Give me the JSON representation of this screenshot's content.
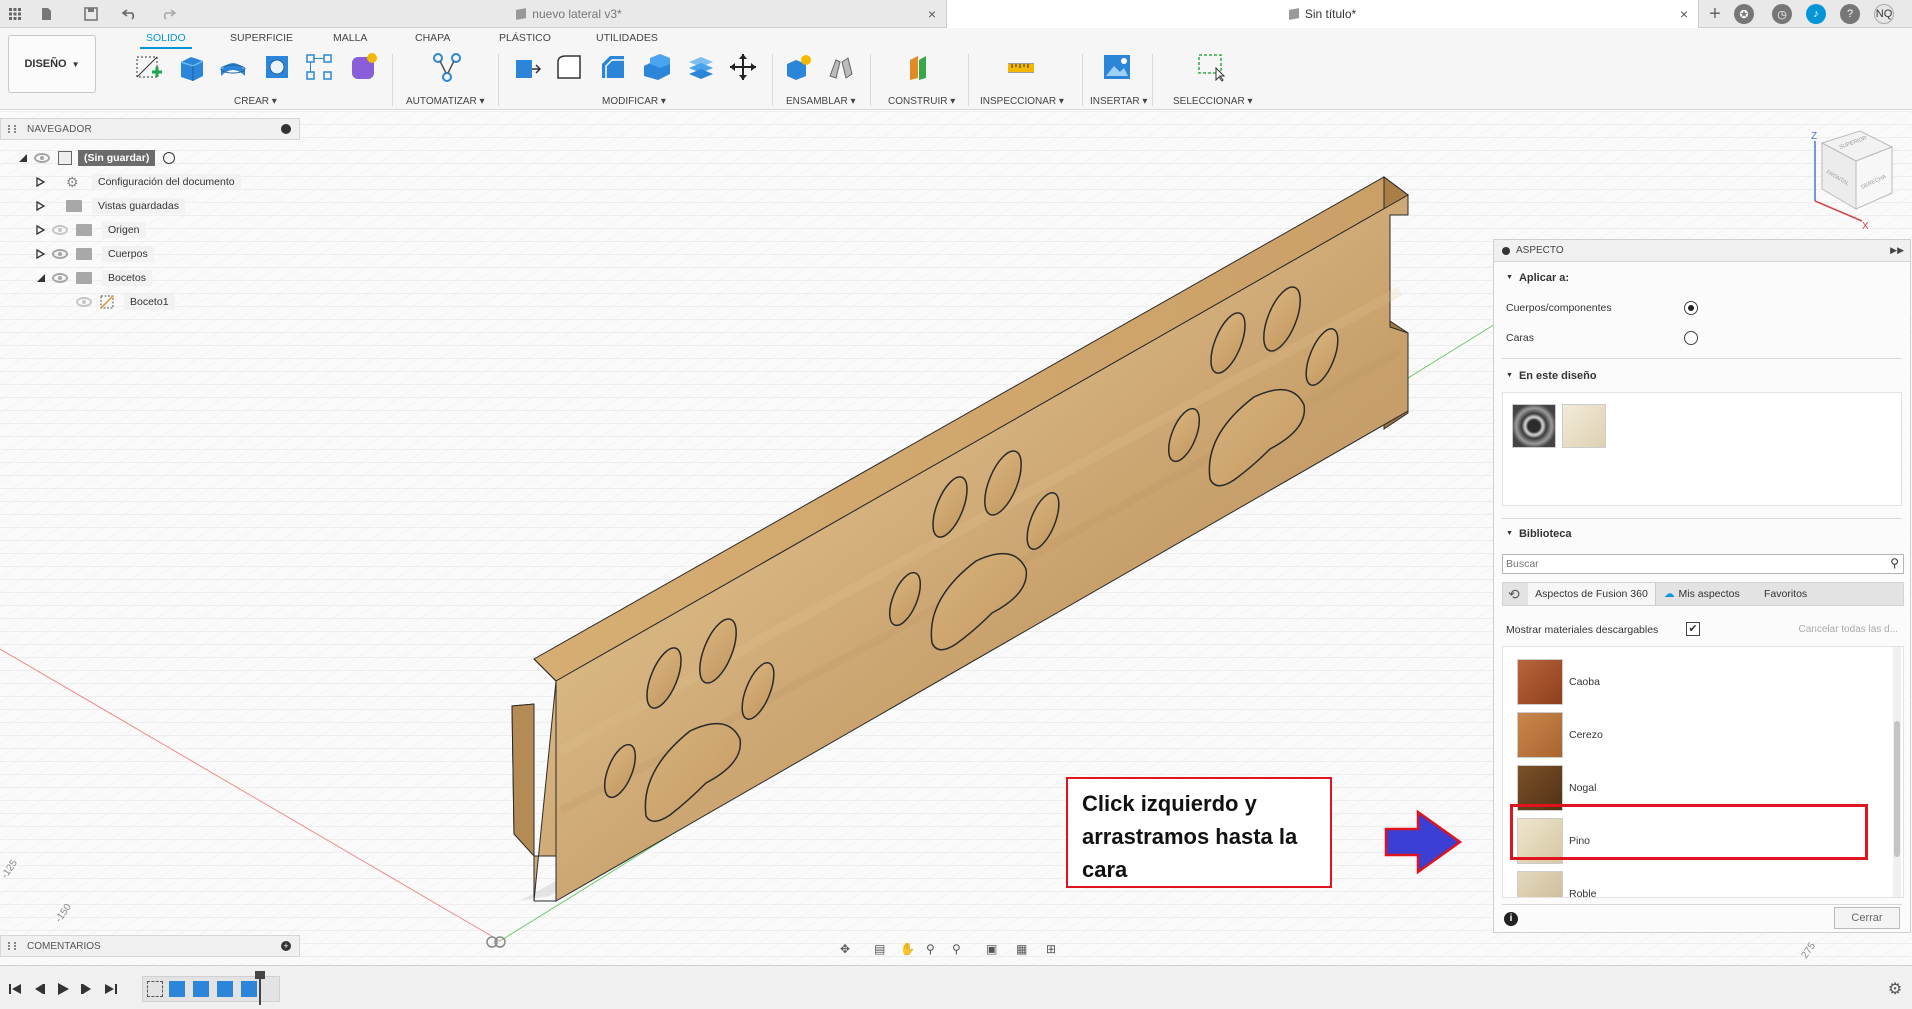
{
  "titlebar": {
    "tabs": [
      {
        "label": "nuevo lateral v3*",
        "active": false
      },
      {
        "label": "Sin título*",
        "active": true
      }
    ],
    "user_initials": "NQ"
  },
  "ribbon": {
    "workspace": "DISEÑO",
    "tabs": [
      "SOLIDO",
      "SUPERFICIE",
      "MALLA",
      "CHAPA",
      "PLÁSTICO",
      "UTILIDADES"
    ],
    "active_tab": "SOLIDO",
    "groups": [
      "CREAR",
      "AUTOMATIZAR",
      "MODIFICAR",
      "ENSAMBLAR",
      "CONSTRUIR",
      "INSPECCIONAR",
      "INSERTAR",
      "SELECCIONAR"
    ]
  },
  "navigator": {
    "title": "NAVEGADOR",
    "root": "(Sin guardar)",
    "items": [
      {
        "label": "Configuración del documento"
      },
      {
        "label": "Vistas guardadas"
      },
      {
        "label": "Origen"
      },
      {
        "label": "Cuerpos"
      },
      {
        "label": "Bocetos"
      },
      {
        "label": "Boceto1"
      }
    ]
  },
  "comments": {
    "title": "COMENTARIOS"
  },
  "viewcube": {
    "axis_z": "Z",
    "axis_x": "X",
    "face_top": "SUPERIOR",
    "face_front": "FRONTAL",
    "face_right": "DERECHA"
  },
  "grid_labels": {
    "left_a": "-125",
    "left_b": "-150",
    "right": "275"
  },
  "aspecto": {
    "title": "ASPECTO",
    "apply_section": "Aplicar a:",
    "option_bodies": "Cuerpos/componentes",
    "option_faces": "Caras",
    "design_section": "En este diseño",
    "library_section": "Biblioteca",
    "search_placeholder": "Buscar",
    "lib_tab_fusion": "Aspectos de Fusion 360",
    "lib_tab_mine": "Mis aspectos",
    "lib_tab_fav": "Favoritos",
    "show_downloadable": "Mostrar materiales descargables",
    "cancel_all": "Cancelar todas las d...",
    "materials": [
      {
        "name": "Caoba",
        "color": "#a4542e"
      },
      {
        "name": "Cerezo",
        "color": "#b8743f"
      },
      {
        "name": "Nogal",
        "color": "#6b4220"
      },
      {
        "name": "Pino",
        "color": "#e2d6b8"
      },
      {
        "name": "Roble",
        "color": "#d8cbb0"
      }
    ],
    "close_label": "Cerrar"
  },
  "annotation": {
    "text": "Click izquierdo y arrastramos hasta la cara",
    "border_color": "#e0141e",
    "arrow_color": "#3b3fd4"
  }
}
